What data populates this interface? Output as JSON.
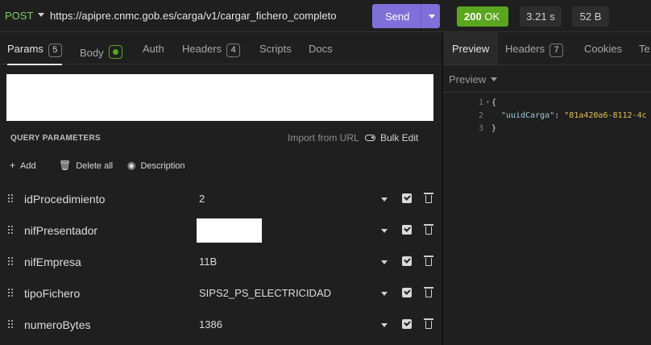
{
  "request": {
    "method": "POST",
    "url": "https://apipre.cnmc.gob.es/carga/v1/cargar_fichero_completo",
    "send_label": "Send"
  },
  "response_meta": {
    "status_code": "200",
    "status_text": "OK",
    "time": "3.21 s",
    "size": "52 B"
  },
  "request_tabs": [
    {
      "label": "Params",
      "badge": "5"
    },
    {
      "label": "Body"
    },
    {
      "label": "Auth"
    },
    {
      "label": "Headers",
      "badge": "4"
    },
    {
      "label": "Scripts"
    },
    {
      "label": "Docs"
    }
  ],
  "query": {
    "title": "QUERY PARAMETERS",
    "import_label": "Import from URL",
    "bulk_label": "Bulk Edit",
    "add_label": "Add",
    "delete_all_label": "Delete all",
    "description_label": "Description",
    "params": [
      {
        "name": "idProcedimiento",
        "value": "2"
      },
      {
        "name": "nifPresentador",
        "value": ""
      },
      {
        "name": "nifEmpresa",
        "value": "11B"
      },
      {
        "name": "tipoFichero",
        "value": "SIPS2_PS_ELECTRICIDAD"
      },
      {
        "name": "numeroBytes",
        "value": "1386"
      }
    ]
  },
  "response_tabs": [
    {
      "label": "Preview"
    },
    {
      "label": "Headers",
      "badge": "7"
    },
    {
      "label": "Cookies"
    },
    {
      "label": "Te"
    }
  ],
  "preview": {
    "mode_label": "Preview",
    "lines": [
      {
        "num": "1",
        "text": "{"
      },
      {
        "num": "2",
        "key": "\"uuidCarga\"",
        "sep": ": ",
        "value": "\"81a420a6-8112-4c"
      },
      {
        "num": "3",
        "text": "}"
      }
    ]
  },
  "colors": {
    "method": "#83c95f",
    "send": "#7f6fd9",
    "status_ok": "#5aa61e",
    "json_key": "#9fc9d9",
    "json_string": "#e3c04f"
  }
}
